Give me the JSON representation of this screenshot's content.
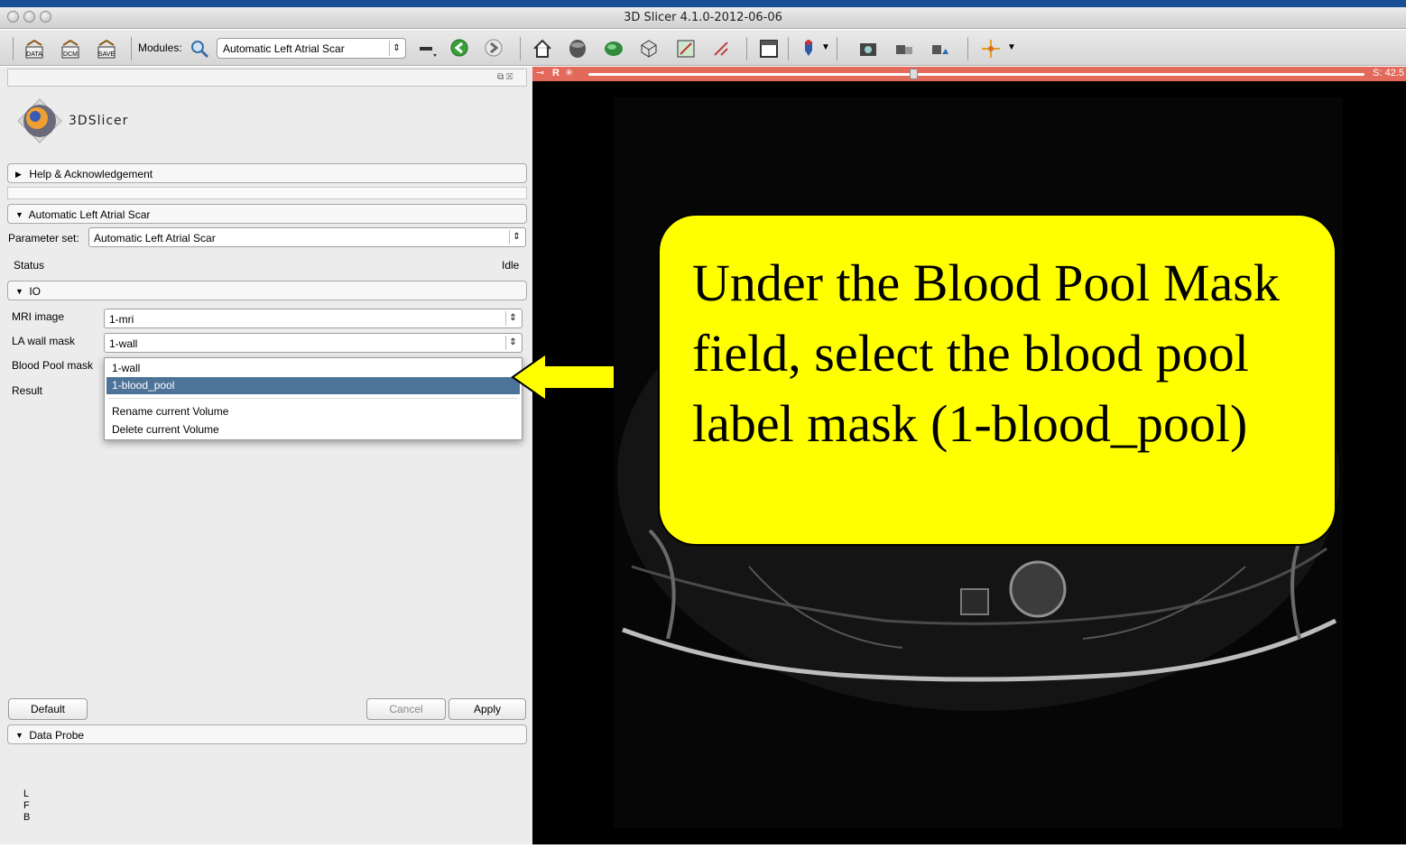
{
  "window": {
    "title": "3D Slicer 4.1.0-2012-06-06"
  },
  "toolbar": {
    "data_icon_label": "DATA",
    "dcm_icon_label": "DCM",
    "save_icon_label": "SAVE",
    "modules_label": "Modules:",
    "module_selected": "Automatic Left Atrial Scar"
  },
  "panel": {
    "logo_text": "3DSlicer",
    "help_section": "Help & Acknowledgement",
    "module_section": "Automatic Left Atrial Scar",
    "parameter_set_label": "Parameter set:",
    "parameter_set_value": "Automatic Left Atrial Scar",
    "status_label": "Status",
    "status_value": "Idle",
    "io_section": "IO",
    "mri_label": "MRI image",
    "mri_value": "1-mri",
    "wall_label": "LA wall mask",
    "wall_value": "1-wall",
    "pool_label": "Blood Pool mask",
    "result_label": "Result",
    "dropdown": {
      "options": [
        "1-wall",
        "1-blood_pool"
      ],
      "selected": "1-blood_pool",
      "rename": "Rename current Volume",
      "delete": "Delete current Volume"
    },
    "default_button": "Default",
    "cancel_button": "Cancel",
    "apply_button": "Apply",
    "data_probe_section": "Data Probe",
    "probe_l": "L",
    "probe_f": "F",
    "probe_b": "B"
  },
  "viewer": {
    "orientation": "R",
    "slice_offset": "S: 42.5",
    "slice_color": "#e36a5a"
  },
  "callout": {
    "text": "Under the Blood Pool Mask field, select the blood pool label mask (1-blood_pool)",
    "background": "#ffff00"
  }
}
